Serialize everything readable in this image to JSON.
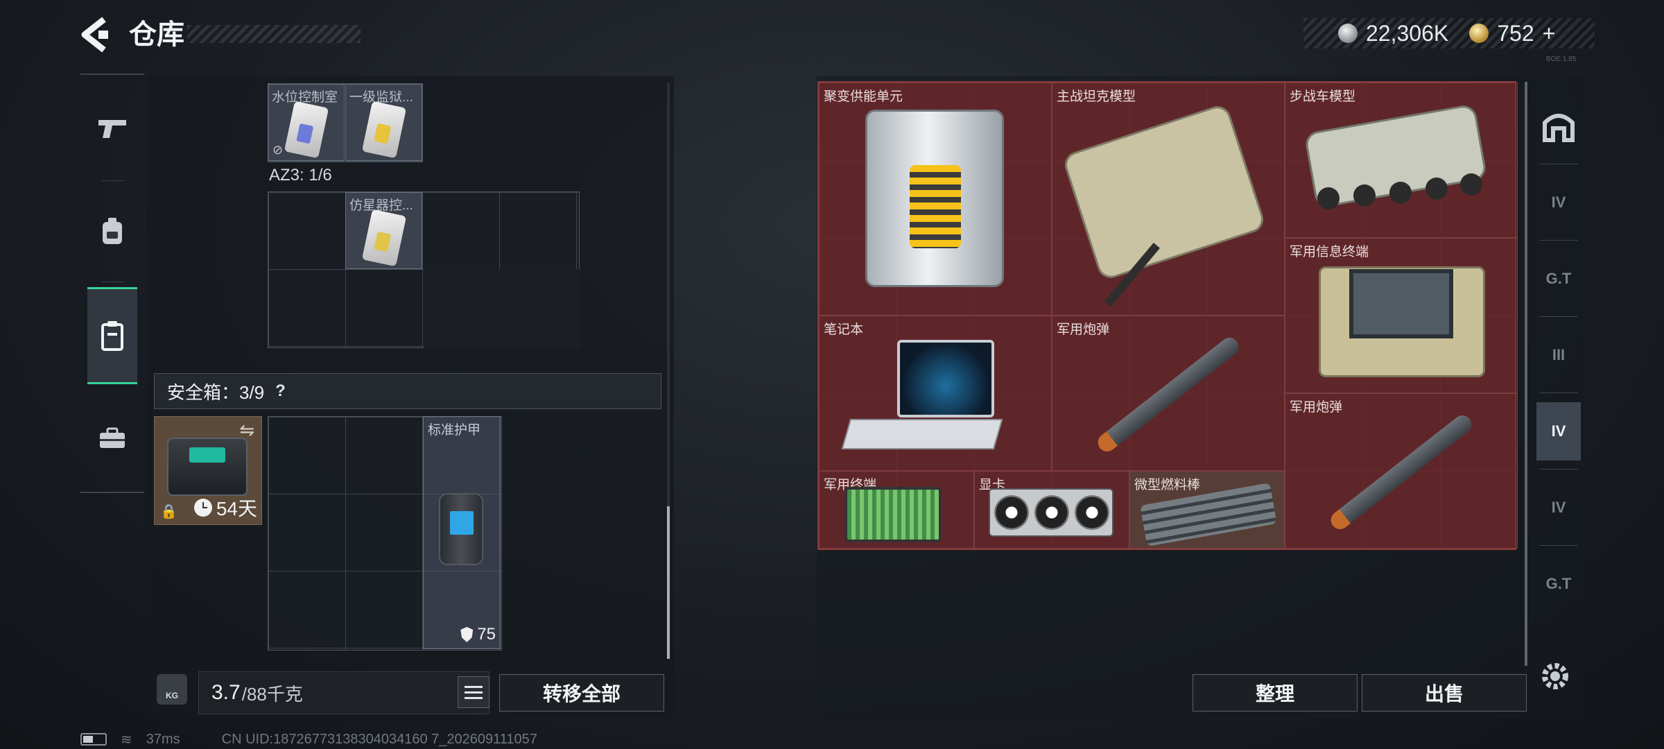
{
  "header": {
    "title": "仓库",
    "currency_silver": "22,306K",
    "currency_gold": "752",
    "gold_add": "+",
    "build_tag": "BOE 1.85"
  },
  "container": {
    "top_items": [
      {
        "label": "水位控制室",
        "chip_color": "#6c7bd8",
        "badge": "⊘"
      },
      {
        "label": "一级监狱...",
        "chip_color": "#e8c23a"
      }
    ],
    "az3_label": "AZ3: 1/6",
    "az3_item": {
      "label": "仿星器控...",
      "chip_color": "#e0c54a"
    }
  },
  "safebox": {
    "title": "安全箱：3/9",
    "help": "?",
    "swap_icon": "⇋",
    "lock_icon": "🔒",
    "timer": "54天",
    "armor": {
      "label": "标准护甲",
      "durability": "75"
    }
  },
  "weight": {
    "icon_text": "KG",
    "current": "3.7",
    "max": "/88千克"
  },
  "buttons": {
    "transfer_all": "转移全部",
    "sort": "整理",
    "sell": "出售"
  },
  "stash_items": [
    {
      "id": "fusion",
      "label": "聚变供能单元"
    },
    {
      "id": "tank",
      "label": "主战坦克模型"
    },
    {
      "id": "ifv",
      "label": "步战车模型"
    },
    {
      "id": "terminal",
      "label": "军用信息终端"
    },
    {
      "id": "laptop",
      "label": "笔记本"
    },
    {
      "id": "shell1",
      "label": "军用炮弹"
    },
    {
      "id": "shell2",
      "label": "军用炮弹"
    },
    {
      "id": "mil_terminal",
      "label": "军用终端"
    },
    {
      "id": "gpu",
      "label": "显卡"
    },
    {
      "id": "rods",
      "label": "微型燃料棒"
    }
  ],
  "right_tabs": [
    "home",
    "IV",
    "G.T",
    "III",
    "IV",
    "IV",
    "G.T"
  ],
  "status": {
    "ping": "37ms",
    "uid": "CN UID:18726773138304034160 7_202609111057"
  },
  "colors": {
    "accent": "#38d39a",
    "stash_red": "#4f2327"
  }
}
